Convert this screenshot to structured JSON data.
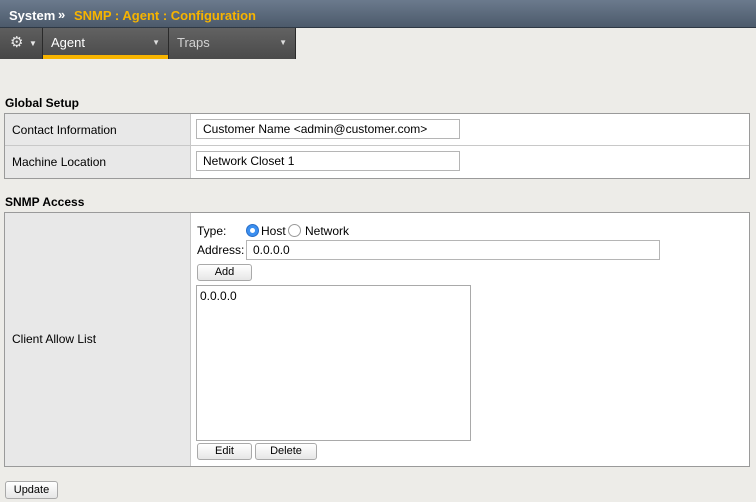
{
  "breadcrumb": {
    "root": "System",
    "separator": "»",
    "current": "SNMP : Agent : Configuration"
  },
  "tabs": [
    {
      "label": "Agent",
      "selected": true
    },
    {
      "label": "Traps",
      "selected": false
    }
  ],
  "icons": {
    "settings": "gear-icon",
    "dropdown": "chevron-down-icon"
  },
  "colors": {
    "accent": "#f7b400",
    "titlebar": "#5b6a7c"
  },
  "global_setup": {
    "title": "Global Setup",
    "contact": {
      "label": "Contact Information",
      "value": "Customer Name <admin@customer.com>"
    },
    "location": {
      "label": "Machine Location",
      "value": "Network Closet 1"
    }
  },
  "snmp_access": {
    "title": "SNMP Access",
    "client_allow_list": {
      "label": "Client Allow List",
      "type_label": "Type:",
      "type_options": [
        {
          "label": "Host",
          "selected": true
        },
        {
          "label": "Network",
          "selected": false
        }
      ],
      "address_label": "Address:",
      "address_value": "0.0.0.0",
      "add_label": "Add",
      "entries": [
        "0.0.0.0"
      ],
      "edit_label": "Edit",
      "delete_label": "Delete"
    }
  },
  "update_label": "Update"
}
